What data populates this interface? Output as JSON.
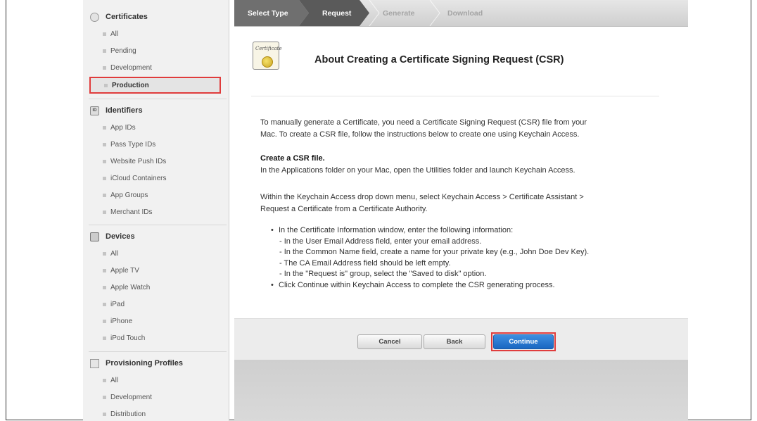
{
  "sidebar": {
    "sections": [
      {
        "title": "Certificates",
        "items": [
          "All",
          "Pending",
          "Development",
          "Production"
        ]
      },
      {
        "title": "Identifiers",
        "items": [
          "App IDs",
          "Pass Type IDs",
          "Website Push IDs",
          "iCloud Containers",
          "App Groups",
          "Merchant IDs"
        ]
      },
      {
        "title": "Devices",
        "items": [
          "All",
          "Apple TV",
          "Apple Watch",
          "iPad",
          "iPhone",
          "iPod Touch"
        ]
      },
      {
        "title": "Provisioning Profiles",
        "items": [
          "All",
          "Development",
          "Distribution"
        ]
      }
    ],
    "id_badge": "ID"
  },
  "steps": [
    "Select Type",
    "Request",
    "Generate",
    "Download"
  ],
  "content": {
    "cert_icon_text": "Certificate",
    "title": "About Creating a Certificate Signing Request (CSR)",
    "intro_line1": "To manually generate a Certificate, you need a Certificate Signing Request (CSR) file from your",
    "intro_line2": "Mac. To create a CSR file, follow the instructions below to create one using Keychain Access.",
    "create_heading": "Create a CSR file.",
    "create_text": "In the Applications folder on your Mac, open the Utilities folder and launch Keychain Access.",
    "menu_line1": "Within the Keychain Access drop down menu, select Keychain Access > Certificate Assistant >",
    "menu_line2": "Request a Certificate from a Certificate Authority.",
    "bullet1": "In the Certificate Information window, enter the following information:",
    "sub1": "- In the User Email Address field, enter your email address.",
    "sub2": "- In the Common Name field, create a name for your private key (e.g., John Doe Dev Key).",
    "sub3": "- The CA Email Address field should be left empty.",
    "sub4": "- In the \"Request is\" group, select the \"Saved to disk\" option.",
    "bullet2": "Click Continue within Keychain Access to complete the CSR generating process.",
    "bullet_char": "•"
  },
  "buttons": {
    "cancel": "Cancel",
    "back": "Back",
    "continue": "Continue"
  },
  "colors": {
    "highlight": "#e03c3c",
    "primary": "#1a67c1",
    "step_active": "#6f6f6f"
  }
}
